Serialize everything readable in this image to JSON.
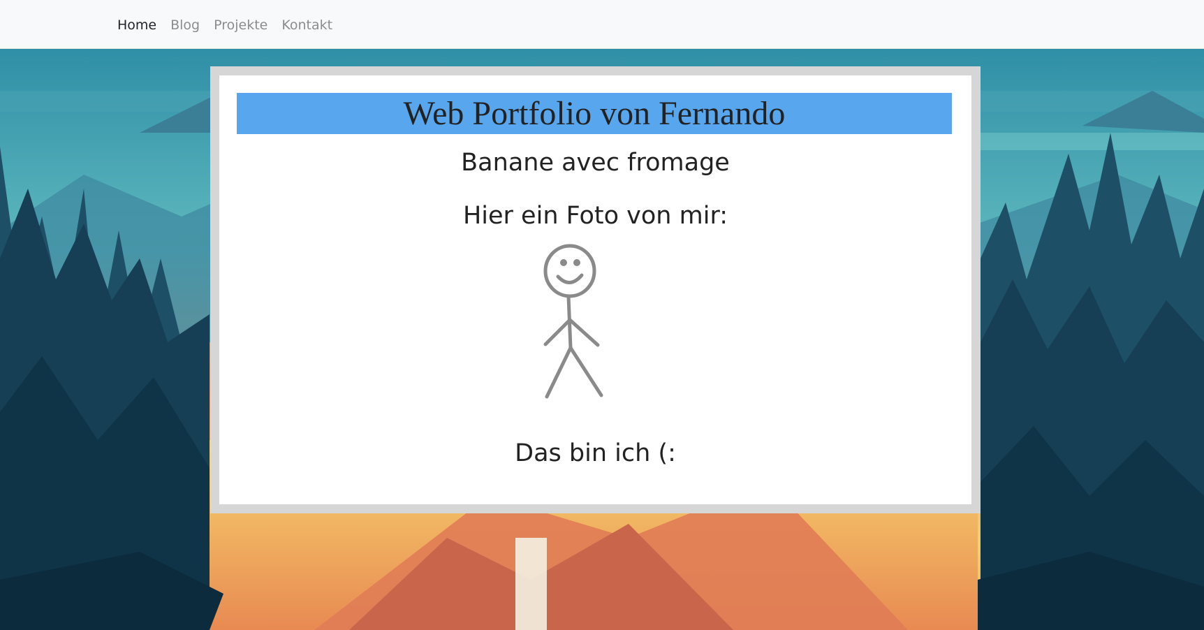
{
  "nav": {
    "items": [
      {
        "label": "Home",
        "active": true
      },
      {
        "label": "Blog",
        "active": false
      },
      {
        "label": "Projekte",
        "active": false
      },
      {
        "label": "Kontakt",
        "active": false
      }
    ]
  },
  "content": {
    "title": "Web Portfolio von Fernando",
    "subtitle": "Banane avec fromage",
    "photo_intro": "Hier ein Foto von mir:",
    "photo_icon": "stick-figure-drawing",
    "caption": "Das bin ich (:"
  },
  "colors": {
    "title_bar": "#58a7ee",
    "navbar_bg": "#f8f9fa",
    "card_frame": "#d6d6d6"
  }
}
